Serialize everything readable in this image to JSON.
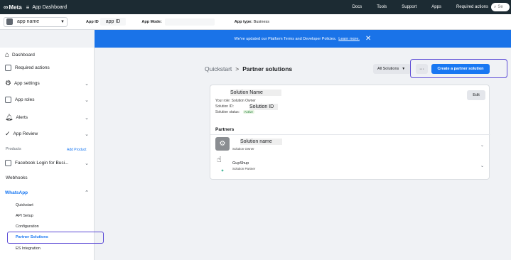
{
  "topbar": {
    "logo": "Meta",
    "app_dashboard": "App Dashboard",
    "links": [
      "Docs",
      "Tools",
      "Support",
      "Apps",
      "Required actions"
    ],
    "search_placeholder": "Se"
  },
  "appbar": {
    "app_name": "app name",
    "app_id_label": "App ID",
    "app_id_value": "app ID",
    "app_mode_label": "App Mode:",
    "app_type_label": "App type:",
    "app_type_value": "Business"
  },
  "banner": {
    "text": "We've updated our Platform Terms and Developer Policies.",
    "link": "Learn more."
  },
  "sidebar": {
    "items": [
      {
        "label": "Dashboard"
      },
      {
        "label": "Required actions"
      },
      {
        "label": "App settings"
      },
      {
        "label": "App roles"
      },
      {
        "label": "Alerts"
      },
      {
        "label": "App Review"
      }
    ],
    "products_heading": "Products",
    "add_product": "Add Product",
    "fb_login": "Facebook Login for Busi...",
    "webhooks": "Webhooks",
    "whatsapp": "WhatsApp",
    "whatsapp_items": [
      "Quickstart",
      "API Setup",
      "Configuration",
      "Partner Solutions",
      "ES Integration"
    ]
  },
  "main": {
    "breadcrumb_parent": "Quickstart",
    "breadcrumb_sep": ">",
    "page_title": "Partner solutions",
    "filter": "All Solutions",
    "more": "···",
    "create_button": "Create a partner solution",
    "card": {
      "solution_name": "Solution Name",
      "role": "Your role: Solution Owner",
      "solution_id_label": "Solution ID:",
      "solution_id_value": "Solution ID",
      "status_label": "Solution status:",
      "status_value": "Active",
      "edit": "Edit",
      "partners_heading": "Partners",
      "partners": [
        {
          "name": "Solution name",
          "role": "Solution Owner"
        },
        {
          "name": "GupShup",
          "role": "Solution Partner"
        }
      ]
    }
  }
}
